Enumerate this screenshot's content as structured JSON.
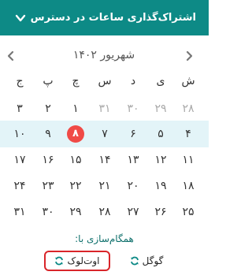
{
  "header": {
    "title": "اشتراک‌گذاری ساعات در دسترس"
  },
  "calendar": {
    "month_label": "شهریور ۱۴۰۲",
    "weekdays": [
      "ش",
      "ی",
      "د",
      "س",
      "چ",
      "پ",
      "ج"
    ],
    "weeks": [
      [
        "۲۸",
        "۲۹",
        "۳۰",
        "۳۱",
        "۱",
        "۲",
        "۳"
      ],
      [
        "۴",
        "۵",
        "۶",
        "۷",
        "۸",
        "۹",
        "۱۰"
      ],
      [
        "۱۱",
        "۱۲",
        "۱۳",
        "۱۴",
        "۱۵",
        "۱۶",
        "۱۷"
      ],
      [
        "۱۸",
        "۱۹",
        "۲۰",
        "۲۱",
        "۲۲",
        "۲۳",
        "۲۴"
      ],
      [
        "۲۵",
        "۲۶",
        "۲۷",
        "۲۸",
        "۲۹",
        "۳۰",
        "۳۱"
      ]
    ],
    "dim_cells": [
      [
        0,
        0
      ],
      [
        0,
        1
      ],
      [
        0,
        2
      ],
      [
        0,
        3
      ]
    ],
    "current_week_index": 1,
    "today": {
      "week": 1,
      "col": 4
    }
  },
  "sync": {
    "label": "همگام‌سازی با:",
    "google_label": "گوگل",
    "outlook_label": "اوت‌لوک"
  },
  "colors": {
    "header_bg": "#0d8a86",
    "today_bg": "#f04a46",
    "current_week_bg": "#e3f4f8",
    "outlook_border": "#d9252a",
    "accent": "#0d8a86"
  }
}
